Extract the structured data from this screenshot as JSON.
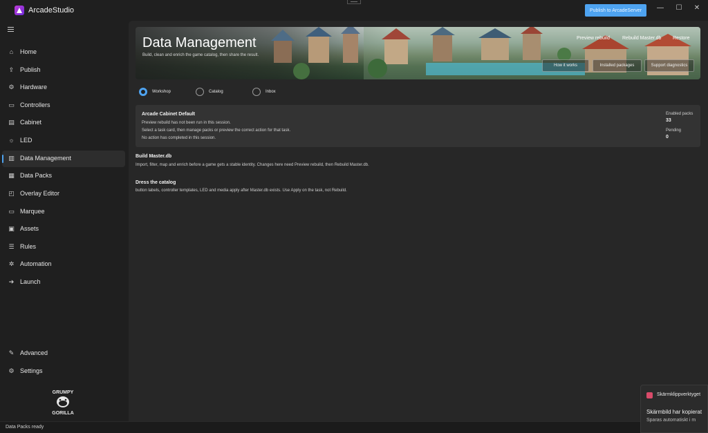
{
  "app": {
    "title": "ArcadeStudio"
  },
  "titlebar": {
    "publish_label": "Publish to ArcadeServer",
    "minimize": "—",
    "maximize": "☐",
    "close": "✕"
  },
  "sidebar": {
    "items": [
      {
        "label": "Home",
        "icon": "home-icon",
        "glyph": "⌂"
      },
      {
        "label": "Publish",
        "icon": "publish-icon",
        "glyph": "⇪"
      },
      {
        "label": "Hardware",
        "icon": "hardware-icon",
        "glyph": "⚙"
      },
      {
        "label": "Controllers",
        "icon": "controller-icon",
        "glyph": "▭"
      },
      {
        "label": "Cabinet",
        "icon": "cabinet-icon",
        "glyph": "▤"
      },
      {
        "label": "LED",
        "icon": "led-icon",
        "glyph": "☼"
      },
      {
        "label": "Data Management",
        "icon": "database-icon",
        "glyph": "▥"
      },
      {
        "label": "Data Packs",
        "icon": "data-packs-icon",
        "glyph": "▦"
      },
      {
        "label": "Overlay Editor",
        "icon": "overlay-icon",
        "glyph": "◰"
      },
      {
        "label": "Marquee",
        "icon": "marquee-icon",
        "glyph": "▭"
      },
      {
        "label": "Assets",
        "icon": "assets-icon",
        "glyph": "▣"
      },
      {
        "label": "Rules",
        "icon": "rules-icon",
        "glyph": "☰"
      },
      {
        "label": "Automation",
        "icon": "automation-icon",
        "glyph": "✲"
      },
      {
        "label": "Launch",
        "icon": "launch-icon",
        "glyph": "➔"
      }
    ],
    "bottom_items": [
      {
        "label": "Advanced",
        "icon": "wrench-icon",
        "glyph": "✎"
      },
      {
        "label": "Settings",
        "icon": "settings-icon",
        "glyph": "⚙"
      }
    ],
    "logo_text_top": "GRUMPY",
    "logo_text_bottom": "GORILLA"
  },
  "hero": {
    "title": "Data Management",
    "subtitle": "Build, clean and enrich the game catalog, then share the result.",
    "links": [
      "Preview rebuild",
      "Rebuild Master.db",
      "Restore"
    ],
    "buttons": [
      "How it works",
      "Installed packages",
      "Support diagnostics"
    ]
  },
  "tabs": [
    {
      "label": "Workshop",
      "checked": true
    },
    {
      "label": "Catalog",
      "checked": false
    },
    {
      "label": "Inbox",
      "checked": false
    }
  ],
  "card": {
    "title": "Arcade Cabinet Default",
    "lines": [
      "Preview rebuild has not been run in this session.",
      "Select a task card, then manage packs or preview the correct action for that task.",
      "No action has completed in this session."
    ],
    "stats": [
      {
        "label": "Enabled packs",
        "value": "33"
      },
      {
        "label": "Pending",
        "value": "0"
      }
    ]
  },
  "sections": [
    {
      "title": "Build Master.db",
      "desc": "Import, filter, map and enrich before a game gets a stable identity. Changes here need Preview rebuild, then Rebuild Master.db."
    },
    {
      "title": "Dress the catalog",
      "desc": "button labels, controller templates, LED and media apply after Master.db exists. Use Apply on the task, not Rebuild."
    }
  ],
  "status": {
    "text": "Data Packs ready"
  },
  "toast": {
    "app": "Skärmklippverktyget",
    "title": "Skärmbild har kopierat",
    "body": "Sparas automatiskt i m"
  },
  "colors": {
    "accent": "#4ea3f0",
    "background": "#1f1f1f",
    "panel": "#272727",
    "card": "#333333"
  }
}
